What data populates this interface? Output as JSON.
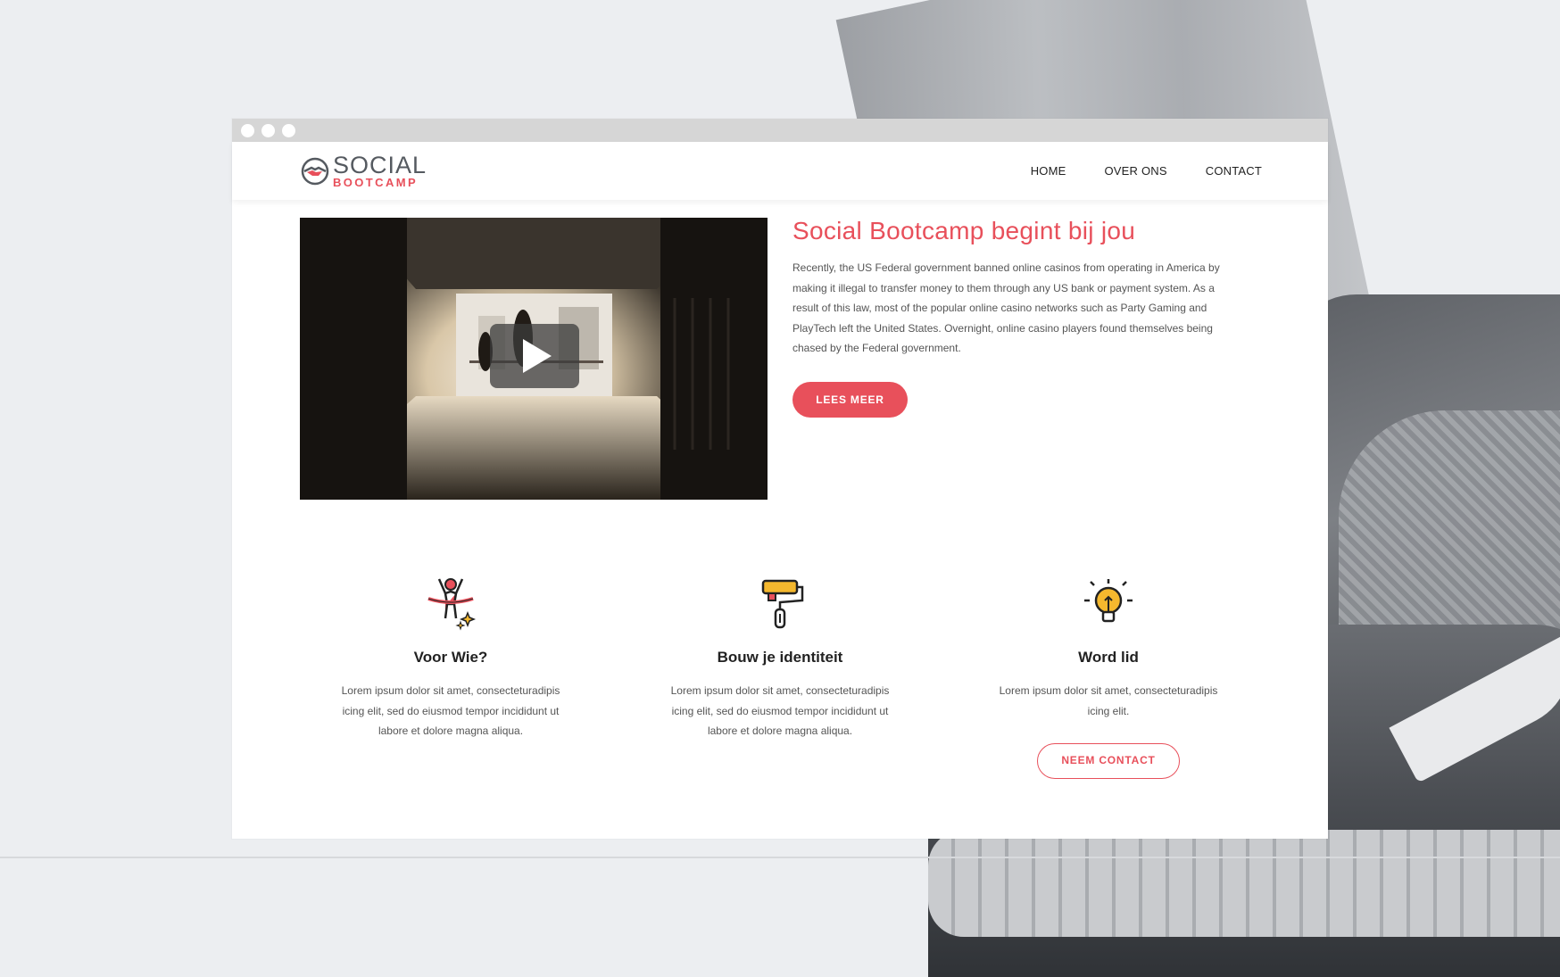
{
  "browser": {
    "window_dots": 3
  },
  "header": {
    "logo": {
      "line1": "SOCIAL",
      "line2": "BOOTCAMP"
    },
    "nav": [
      "HOME",
      "OVER ONS",
      "CONTACT"
    ]
  },
  "hero": {
    "title": "Social Bootcamp begint bij jou",
    "body": "Recently, the US Federal government banned online casinos from operating in America by making it illegal to transfer money to them through any US bank or payment system. As a result of this law, most of the popular online casino networks such as Party Gaming and PlayTech left the United States. Overnight, online casino players found themselves being chased by the Federal government.",
    "button": "LEES MEER",
    "video_icon": "play-icon"
  },
  "features": [
    {
      "icon": "finish-line-runner-icon",
      "title": "Voor Wie?",
      "body": "Lorem ipsum dolor sit amet, consecteturadipis icing elit, sed do eiusmod tempor incididunt ut labore et dolore magna aliqua."
    },
    {
      "icon": "paint-roller-icon",
      "title": "Bouw je identiteit",
      "body": "Lorem ipsum dolor sit amet, consecteturadipis icing elit, sed do eiusmod tempor incididunt ut labore et dolore magna aliqua."
    },
    {
      "icon": "lightbulb-icon",
      "title": "Word lid",
      "body": "Lorem ipsum dolor sit amet, consecteturadipis icing elit.",
      "button": "NEEM CONTACT"
    }
  ],
  "colors": {
    "accent": "#e8505b",
    "text": "#222222",
    "muted": "#555555",
    "icon_yellow": "#f5b82e"
  }
}
